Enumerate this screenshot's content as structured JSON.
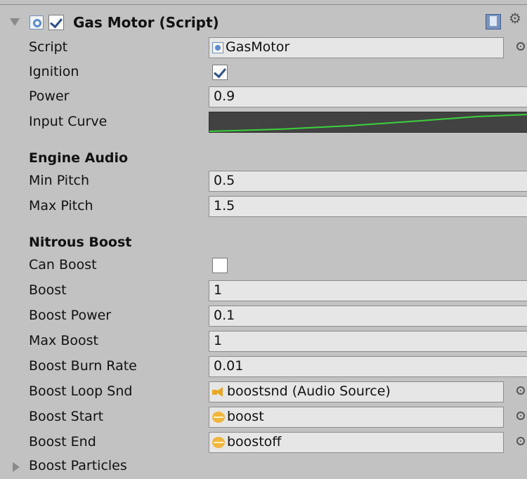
{
  "component": {
    "title": "Gas Motor (Script)",
    "enabled": true
  },
  "fields": {
    "script": {
      "label": "Script",
      "value": "GasMotor",
      "icon": "script-icon"
    },
    "ignition": {
      "label": "Ignition",
      "checked": true
    },
    "power": {
      "label": "Power",
      "value": "0.9"
    },
    "input_curve": {
      "label": "Input Curve",
      "curve_color": "#3cd23c"
    }
  },
  "sections": {
    "engine_audio": {
      "title": "Engine Audio",
      "min_pitch": {
        "label": "Min Pitch",
        "value": "0.5"
      },
      "max_pitch": {
        "label": "Max Pitch",
        "value": "1.5"
      }
    },
    "nitrous_boost": {
      "title": "Nitrous Boost",
      "can_boost": {
        "label": "Can Boost",
        "checked": false
      },
      "boost": {
        "label": "Boost",
        "value": "1"
      },
      "boost_power": {
        "label": "Boost Power",
        "value": "0.1"
      },
      "max_boost": {
        "label": "Max Boost",
        "value": "1"
      },
      "boost_burn_rate": {
        "label": "Boost Burn Rate",
        "value": "0.01"
      },
      "boost_loop_snd": {
        "label": "Boost Loop Snd",
        "value": "boostsnd (Audio Source)",
        "icon": "audio-source-icon"
      },
      "boost_start": {
        "label": "Boost Start",
        "value": "boost",
        "icon": "audio-clip-icon"
      },
      "boost_end": {
        "label": "Boost End",
        "value": "boostoff",
        "icon": "audio-clip-icon"
      },
      "boost_particles": {
        "label": "Boost Particles"
      }
    }
  },
  "colors": {
    "panel_bg": "#c2c2c2",
    "field_bg": "#e6e6e6",
    "curve_bg": "#424242",
    "curve_line": "#3cd23c"
  }
}
